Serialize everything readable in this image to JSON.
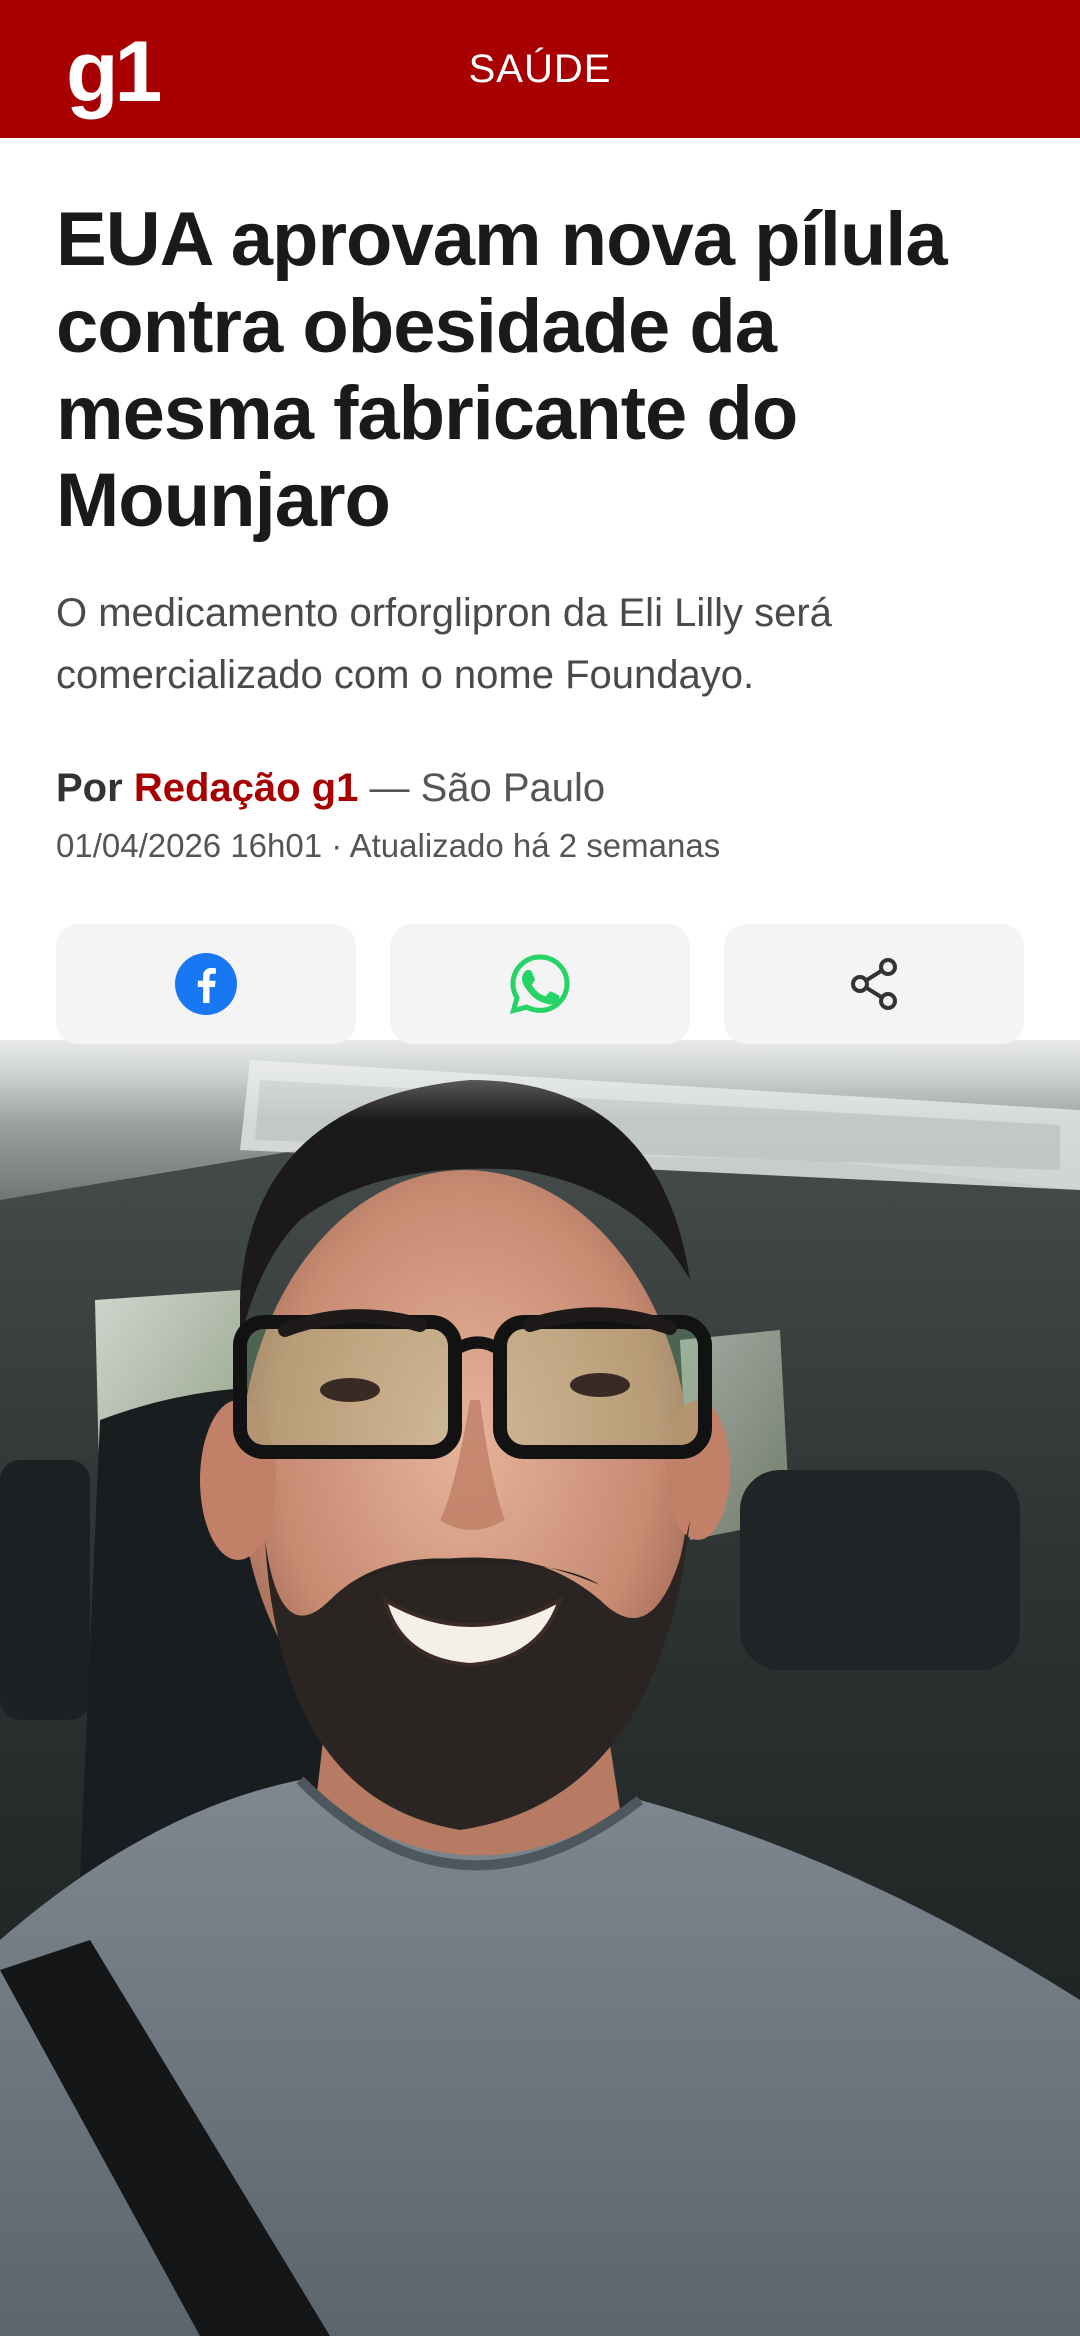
{
  "header": {
    "logo": "g1",
    "section": "SAÚDE",
    "brand_color": "#a80000"
  },
  "article": {
    "headline": "EUA aprovam nova pílula contra obesidade da mesma fabricante do Mounjaro",
    "subheadline": "O medicamento orforglipron da Eli Lilly será comercializado com o nome Foundayo.",
    "byline_prefix": "Por",
    "author": "Redação g1",
    "location": "— São Paulo",
    "published": "01/04/2026 16h01",
    "updated": "· Atualizado há 2 semanas"
  },
  "share": {
    "buttons": [
      {
        "icon": "facebook-icon",
        "color": "#1877f2"
      },
      {
        "icon": "whatsapp-icon",
        "color": "#25d366"
      },
      {
        "icon": "share-icon",
        "color": "#333333"
      }
    ]
  },
  "media": {
    "type": "video-frame",
    "subject": "man-selfie-in-car-icon"
  }
}
